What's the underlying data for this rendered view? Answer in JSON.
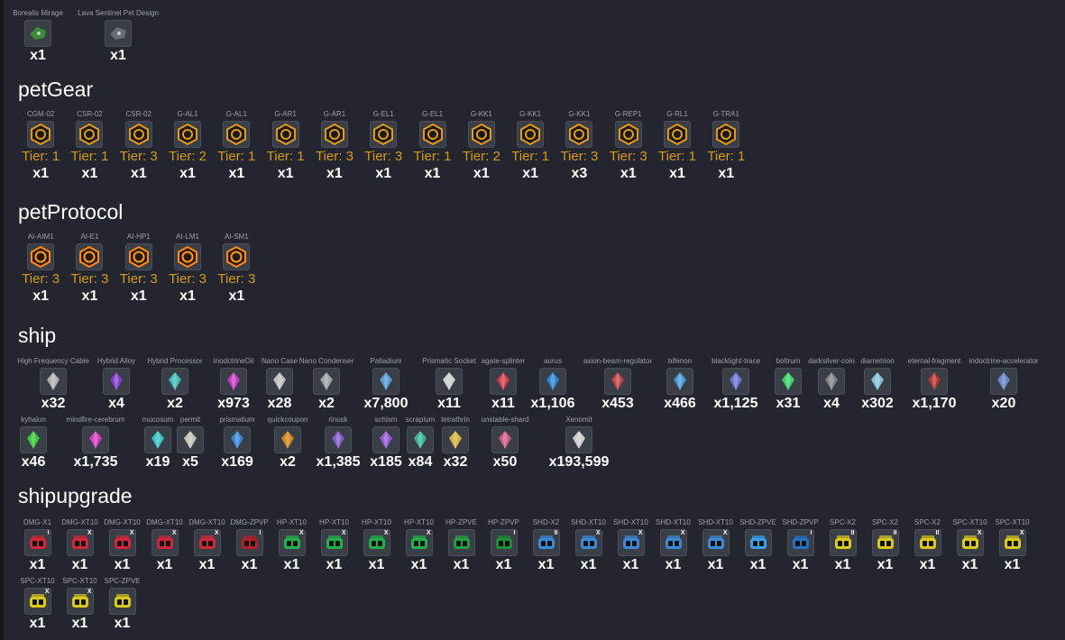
{
  "designs": {
    "items": [
      {
        "label": "Borealis Mirage",
        "qty": "x1",
        "color": "#3a8a3a"
      },
      {
        "label": "Lava Sentinel Pet Design",
        "qty": "x1",
        "color": "#666b75"
      }
    ]
  },
  "petGear": {
    "title": "petGear",
    "items": [
      {
        "label": "CGM-02",
        "tier": "Tier: 1",
        "qty": "x1"
      },
      {
        "label": "CSR-02",
        "tier": "Tier: 1",
        "qty": "x1"
      },
      {
        "label": "CSR-02",
        "tier": "Tier: 3",
        "qty": "x1"
      },
      {
        "label": "G-AL1",
        "tier": "Tier: 2",
        "qty": "x1"
      },
      {
        "label": "G-AL1",
        "tier": "Tier: 1",
        "qty": "x1"
      },
      {
        "label": "G-AR1",
        "tier": "Tier: 1",
        "qty": "x1"
      },
      {
        "label": "G-AR1",
        "tier": "Tier: 3",
        "qty": "x1"
      },
      {
        "label": "G-EL1",
        "tier": "Tier: 3",
        "qty": "x1"
      },
      {
        "label": "G-EL1",
        "tier": "Tier: 1",
        "qty": "x1"
      },
      {
        "label": "G-KK1",
        "tier": "Tier: 2",
        "qty": "x1"
      },
      {
        "label": "G-KK1",
        "tier": "Tier: 1",
        "qty": "x1"
      },
      {
        "label": "G-KK1",
        "tier": "Tier: 3",
        "qty": "x3"
      },
      {
        "label": "G-REP1",
        "tier": "Tier: 3",
        "qty": "x1"
      },
      {
        "label": "G-RL1",
        "tier": "Tier: 1",
        "qty": "x1"
      },
      {
        "label": "G-TRA1",
        "tier": "Tier: 1",
        "qty": "x1"
      }
    ]
  },
  "petProtocol": {
    "title": "petProtocol",
    "items": [
      {
        "label": "AI-AIM1",
        "tier": "Tier: 3",
        "qty": "x1"
      },
      {
        "label": "AI-E1",
        "tier": "Tier: 3",
        "qty": "x1"
      },
      {
        "label": "AI-HP1",
        "tier": "Tier: 3",
        "qty": "x1"
      },
      {
        "label": "AI-LM1",
        "tier": "Tier: 3",
        "qty": "x1"
      },
      {
        "label": "AI-SM1",
        "tier": "Tier: 3",
        "qty": "x1"
      }
    ]
  },
  "ship": {
    "title": "ship",
    "row1": [
      {
        "label": "High Frequency Cable",
        "qty": "x32",
        "color": "#bbbbbb"
      },
      {
        "label": "Hybrid Alloy",
        "qty": "x4",
        "color": "#8a3ad6"
      },
      {
        "label": "Hybrid Processor",
        "qty": "x2",
        "color": "#44c4c4"
      },
      {
        "label": "InodctrineOil",
        "qty": "x973",
        "color": "#d63ad0"
      },
      {
        "label": "Nano Case",
        "qty": "x28",
        "color": "#cccccc"
      },
      {
        "label": "Nano Condenser",
        "qty": "x2",
        "color": "#aaaaaa"
      },
      {
        "label": "Palladium",
        "qty": "x7,800",
        "color": "#5aa0e0"
      },
      {
        "label": "Prismatic Socket",
        "qty": "x11",
        "color": "#dddddd"
      },
      {
        "label": "agate-splinter",
        "qty": "x11",
        "color": "#e03a4a"
      },
      {
        "label": "aurus",
        "qty": "x1,106",
        "color": "#2a8ae0"
      },
      {
        "label": "axion-beam-regulator",
        "qty": "x453",
        "color": "#d04040"
      },
      {
        "label": "bifenon",
        "qty": "x466",
        "color": "#4aa0e0"
      },
      {
        "label": "blacklight-trace",
        "qty": "x1,125",
        "color": "#6a7ae0"
      },
      {
        "label": "boltrum",
        "qty": "x31",
        "color": "#3ae06a"
      },
      {
        "label": "darksilver-coin",
        "qty": "x4",
        "color": "#888888"
      },
      {
        "label": "diametrion",
        "qty": "x302",
        "color": "#8ad0e8"
      },
      {
        "label": "eternal-fragment",
        "qty": "x1,170",
        "color": "#c03030"
      },
      {
        "label": "indoctrine-accelerator",
        "qty": "x20",
        "color": "#6a8ad0"
      }
    ],
    "row2": [
      {
        "label": "kyhalon",
        "qty": "x46",
        "color": "#3ad03a"
      },
      {
        "label": "mindfire-cerebrum",
        "qty": "x1,735",
        "color": "#e03ad0"
      },
      {
        "label": "mucosum",
        "qty": "x19",
        "color": "#3ad0d0"
      },
      {
        "label": "permit",
        "qty": "x5",
        "color": "#d0d0c0"
      },
      {
        "label": "prismatium",
        "qty": "x169",
        "color": "#3a8ae0"
      },
      {
        "label": "quickcoupon",
        "qty": "x2",
        "color": "#e08a1a"
      },
      {
        "label": "rinusk",
        "qty": "x1,385",
        "color": "#8a5ad0"
      },
      {
        "label": "schism",
        "qty": "x185",
        "color": "#a05ae0"
      },
      {
        "label": "scrapium",
        "qty": "x84",
        "color": "#3ac0a0"
      },
      {
        "label": "tetrathrin",
        "qty": "x32",
        "color": "#e0c03a"
      },
      {
        "label": "unstable-shard",
        "qty": "x50",
        "color": "#e05a8a"
      },
      {
        "label": "Xenomit",
        "qty": "x193,599",
        "color": "#dddddd"
      }
    ]
  },
  "shipupgrade": {
    "title": "shipupgrade",
    "row1": [
      {
        "label": "DMG-X1",
        "qty": "x1",
        "color": "#d0283a",
        "badge": "I"
      },
      {
        "label": "DMG-XT10",
        "qty": "x1",
        "color": "#d0283a",
        "badge": "X"
      },
      {
        "label": "DMG-XT10",
        "qty": "x1",
        "color": "#d0283a",
        "badge": "X"
      },
      {
        "label": "DMG-XT10",
        "qty": "x1",
        "color": "#d0283a",
        "badge": "X"
      },
      {
        "label": "DMG-XT10",
        "qty": "x1",
        "color": "#d0283a",
        "badge": "X"
      },
      {
        "label": "DMG-ZPVP",
        "qty": "x1",
        "color": "#b0202a",
        "badge": "I"
      },
      {
        "label": "HP-XT10",
        "qty": "x1",
        "color": "#22b04a",
        "badge": "X"
      },
      {
        "label": "HP-XT10",
        "qty": "x1",
        "color": "#22b04a",
        "badge": "X"
      },
      {
        "label": "HP-XT10",
        "qty": "x1",
        "color": "#22b04a",
        "badge": "X"
      },
      {
        "label": "HP-XT10",
        "qty": "x1",
        "color": "#22b04a",
        "badge": "X"
      },
      {
        "label": "HP-ZPVE",
        "qty": "x1",
        "color": "#22a040",
        "badge": ""
      },
      {
        "label": "HP-ZPVP",
        "qty": "x1",
        "color": "#1e9038",
        "badge": "I"
      },
      {
        "label": "SHD-X2",
        "qty": "x1",
        "color": "#3a8ad8",
        "badge": "II"
      },
      {
        "label": "SHD-XT10",
        "qty": "x1",
        "color": "#3a8ad8",
        "badge": "X"
      },
      {
        "label": "SHD-XT10",
        "qty": "x1",
        "color": "#3a8ad8",
        "badge": "X"
      },
      {
        "label": "SHD-XT10",
        "qty": "x1",
        "color": "#3a8ad8",
        "badge": "X"
      },
      {
        "label": "SHD-XT10",
        "qty": "x1",
        "color": "#3a8ad8",
        "badge": "X"
      },
      {
        "label": "SHD-ZPVE",
        "qty": "x1",
        "color": "#3aa0e8",
        "badge": ""
      },
      {
        "label": "SHD-ZPVP",
        "qty": "x1",
        "color": "#2a70c0",
        "badge": "I"
      },
      {
        "label": "SPC-X2",
        "qty": "x1",
        "color": "#d8c820",
        "badge": "II"
      },
      {
        "label": "SPC-X2",
        "qty": "x1",
        "color": "#d8c820",
        "badge": "II"
      },
      {
        "label": "SPC-X2",
        "qty": "x1",
        "color": "#d8c820",
        "badge": "II"
      },
      {
        "label": "SPC-XT10",
        "qty": "x1",
        "color": "#d8c820",
        "badge": "X"
      },
      {
        "label": "SPC-XT10",
        "qty": "x1",
        "color": "#d8c820",
        "badge": "X"
      }
    ],
    "row2": [
      {
        "label": "SPC-XT10",
        "qty": "x1",
        "color": "#d8c820",
        "badge": "X"
      },
      {
        "label": "SPC-XT10",
        "qty": "x1",
        "color": "#d8c820",
        "badge": "X"
      },
      {
        "label": "SPC-ZPVE",
        "qty": "x1",
        "color": "#d8c820",
        "badge": ""
      }
    ]
  }
}
